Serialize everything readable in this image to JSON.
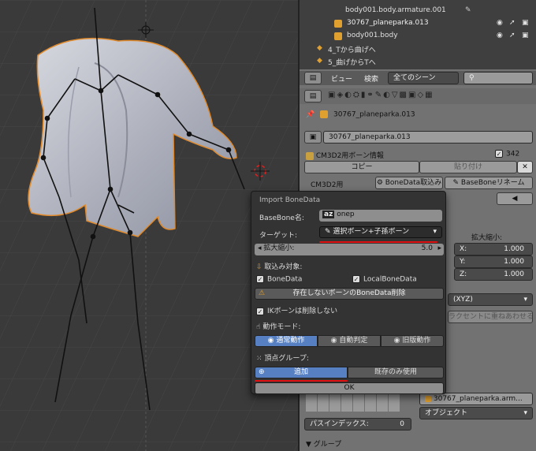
{
  "outliner": {
    "rows": [
      {
        "name": "body001.body.armature.001"
      },
      {
        "name": "30767_planeparka.013"
      },
      {
        "name": "body001.body"
      },
      {
        "name": "4_Tから曲げへ"
      },
      {
        "name": "5_曲げからTへ"
      }
    ]
  },
  "header": {
    "view_label": "ビュー",
    "search_label": "検索",
    "scene_filter": "全てのシーン"
  },
  "properties": {
    "breadcrumb": "30767_planeparka.013",
    "object_name": "30767_planeparka.013",
    "panel_title": "CM3D2用ボーン情報",
    "bone_count": "342",
    "copy_label": "コピー",
    "paste_label": "貼り付け",
    "cm3d2_label": "CM3D2用",
    "bonedata_import": "BoneData取込み",
    "basebone_rename": "BaseBoneリネーム",
    "scale_header": "拡大縮小:",
    "x_label": "X:",
    "x_value": "1.000",
    "y_label": "Y:",
    "y_value": "1.000",
    "z_label": "Z:",
    "z_value": "1.000",
    "rotation_mode_partial": "(XYZ)",
    "partial_button": "ラクセントに重ねあわせる",
    "parent_field": "30767_planeparka.arm...",
    "parent_type": "オブジェクト",
    "pass_index_label": "パスインデックス:",
    "pass_index_value": "0",
    "group_header": "グループ"
  },
  "dialog": {
    "title": "Import BoneData",
    "basebone_label": "BaseBone名:",
    "basebone_value": "onep",
    "target_label": "ターゲット:",
    "target_value": "選択ボーン+子孫ボーン",
    "scale_label": "拡大縮小:",
    "scale_value": "5.0",
    "import_target_label": "取込み対象:",
    "bonedata_check": "BoneData",
    "localbonedata_check": "LocalBoneData",
    "delete_missing": "存在しないボーンのBoneData削除",
    "ik_keep": "IKボーンは削除しない",
    "mode_label": "動作モード:",
    "mode_normal": "通常動作",
    "mode_auto": "自動判定",
    "mode_old": "旧版動作",
    "vgroup_label": "頂点グループ:",
    "vgroup_add": "追加",
    "vgroup_existing": "既存のみ使用",
    "ok_label": "OK"
  },
  "colors": {
    "accent_blue": "#5680c2",
    "warning": "#e0a030",
    "annotation_red": "#e01010"
  }
}
